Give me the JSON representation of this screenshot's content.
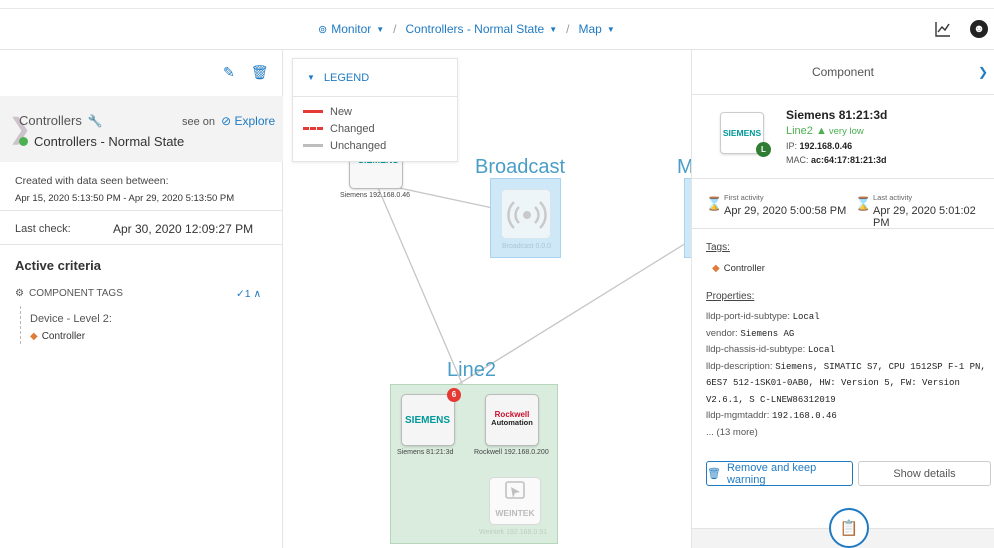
{
  "breadcrumb": {
    "items": [
      {
        "label": "Monitor"
      },
      {
        "label": "Controllers - Normal State"
      },
      {
        "label": "Map"
      }
    ]
  },
  "left_panel": {
    "controllers_label": "Controllers",
    "see_on": "see on",
    "explore_label": "Explore",
    "state_name": "Controllers - Normal State",
    "created_label": "Created with data seen between:",
    "created_range": "Apr 15, 2020 5:13:50 PM - Apr 29, 2020 5:13:50 PM",
    "last_check_label": "Last check:",
    "last_check_value": "Apr 30, 2020 12:09:27 PM",
    "active_criteria": "Active criteria",
    "component_tags": "COMPONENT TAGS",
    "tags_count": "✓1 ∧",
    "device_level": "Device - Level 2:",
    "tag": "Controller"
  },
  "legend": {
    "title": "LEGEND",
    "items": [
      {
        "label": "New",
        "color": "#e53935"
      },
      {
        "label": "Changed",
        "color": "#e53935"
      },
      {
        "label": "Unchanged",
        "color": "#bdbdbd"
      }
    ]
  },
  "map": {
    "zones": {
      "broadcast": "Broadcast",
      "line2": "Line2",
      "partial": "M"
    },
    "nodes": {
      "siemens_top": {
        "logo": "SIEMENS",
        "label": "Siemens 192.168.0.46"
      },
      "broadcast": {
        "label": "Broadcast 0.0.0"
      },
      "siemens_line2": {
        "logo": "SIEMENS",
        "label": "Siemens 81:21:3d",
        "badge": "6"
      },
      "rockwell": {
        "logo_line1": "Rockwell",
        "logo_line2": "Automation",
        "label": "Rockwell 192.168.0.200"
      },
      "weintek": {
        "logo": "WEINTEK",
        "label": "Weintek 192.168.0.91"
      }
    }
  },
  "component": {
    "header": "Component",
    "logo": "SIEMENS",
    "badge": "L",
    "name": "Siemens 81:21:3d",
    "zone": "Line2",
    "risk": "very low",
    "ip_label": "IP:",
    "ip": "192.168.0.46",
    "mac_label": "MAC:",
    "mac": "ac:64:17:81:21:3d",
    "first_activity_label": "First activity",
    "first_activity": "Apr 29, 2020 5:00:58 PM",
    "last_activity_label": "Last activity",
    "last_activity": "Apr 29, 2020 5:01:02 PM",
    "tags_label": "Tags:",
    "tag": "Controller",
    "properties_label": "Properties:",
    "properties": [
      {
        "key": "lldp-port-id-subtype:",
        "value": "Local"
      },
      {
        "key": "vendor:",
        "value": "Siemens AG"
      },
      {
        "key": "lldp-chassis-id-subtype:",
        "value": "Local"
      },
      {
        "key": "lldp-description:",
        "value": "Siemens, SIMATIC S7, CPU 1512SP F-1 PN, 6ES7 512-1SK01-0AB0, HW: Version 5, FW: Version V2.6.1, S C-LNEW86312019"
      },
      {
        "key": "lldp-mgmtaddr:",
        "value": "192.168.0.46"
      }
    ],
    "more": "... (13 more)",
    "remove_button": "Remove and keep warning",
    "details_button": "Show details"
  },
  "colors": {
    "accent": "#1f7ac2",
    "ok_green": "#4caf50",
    "broadcast_zone": "#cfe8f7",
    "line2_zone": "#d9ecdd",
    "new": "#e53935"
  }
}
